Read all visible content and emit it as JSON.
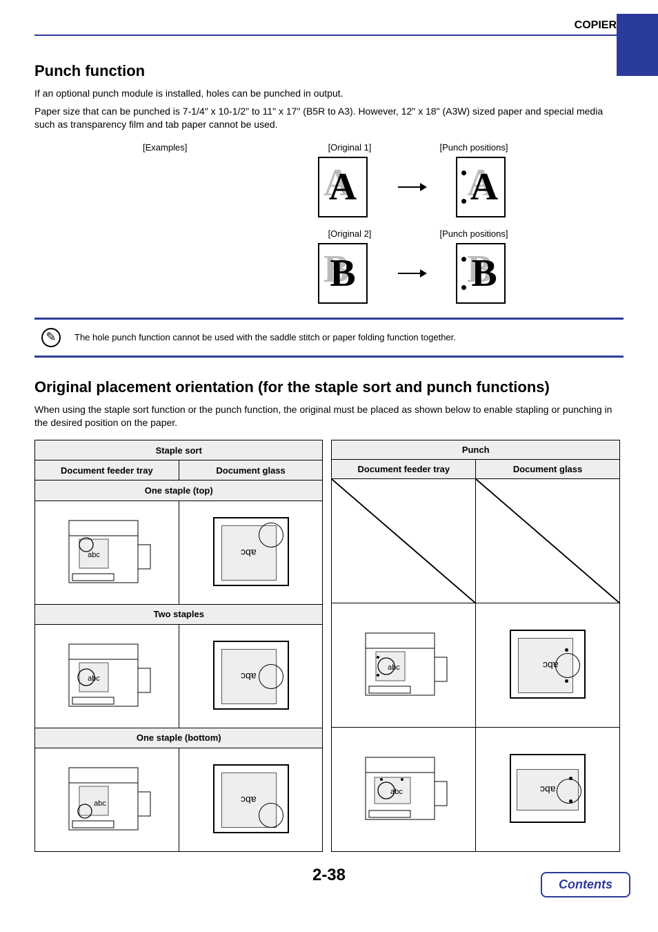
{
  "header": {
    "section": "COPIER"
  },
  "section1": {
    "title": "Punch function",
    "p1": "If an optional punch module is installed, holes can be punched in output.",
    "p2": "Paper size that can be punched is 7-1/4\" x 10-1/2\" to 11\" x 17\" (B5R to A3). However, 12\" x 18\" (A3W) sized paper and special media such as transparency film and tab paper cannot be used.",
    "examples_label": "[Examples]",
    "original1": "[Original 1]",
    "original2": "[Original 2]",
    "punch_positions": "[Punch positions]",
    "letterA": "A",
    "letterB": "B"
  },
  "note": {
    "text": "The hole punch function cannot be used with the saddle stitch or paper folding function together."
  },
  "section2": {
    "title": "Original placement orientation (for the staple sort and punch functions)",
    "p1": "When using the staple sort function or the punch function, the original must be placed as shown below to enable stapling or punching in the desired position on the paper."
  },
  "tables": {
    "staple": {
      "title": "Staple sort",
      "col1": "Document feeder tray",
      "col2": "Document glass",
      "row1": "One staple (top)",
      "row2": "Two staples",
      "row3": "One staple (bottom)"
    },
    "punch": {
      "title": "Punch",
      "col1": "Document feeder tray",
      "col2": "Document glass"
    },
    "abc": "abc"
  },
  "footer": {
    "page": "2-38",
    "contents": "Contents"
  }
}
